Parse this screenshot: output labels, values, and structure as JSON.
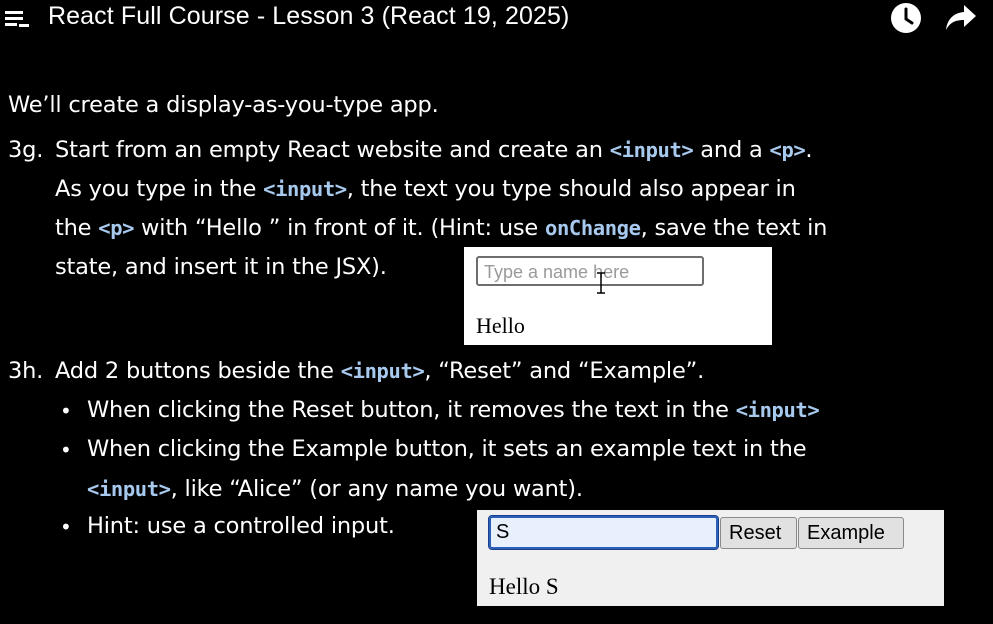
{
  "header": {
    "title": "React Full Course - Lesson 3 (React 19, 2025)",
    "icons": [
      "playlist-menu-icon",
      "watch-later-clock-icon",
      "share-arrow-icon"
    ]
  },
  "slide": {
    "intro": "We’ll create a display-as-you-type app.",
    "task_3g": {
      "number": "3g.",
      "line1_a": "Start from an empty React website and create an ",
      "line1_code1": "<input>",
      "line1_b": " and a ",
      "line1_code2": "<p>",
      "line1_c": ".",
      "line2_a": "As you type in the ",
      "line2_code": "<input>",
      "line2_b": ", the text you type should also appear in",
      "line3_a": "the ",
      "line3_code1": "<p>",
      "line3_b": " with “Hello ” in front of it. (Hint: use ",
      "line3_code2": "onChange",
      "line3_c": ", save the text in",
      "line4": "state, and insert it in the JSX)."
    },
    "demo_3g": {
      "input_placeholder": "Type a name here",
      "output": "Hello"
    },
    "task_3h": {
      "number": "3h.",
      "line1_a": "Add 2 buttons beside the ",
      "line1_code": "<input>",
      "line1_b": ", “Reset” and “Example”.",
      "bullet1_a": "When clicking the Reset button, it removes the text in the ",
      "bullet1_code": "<input>",
      "bullet2_a": "When clicking the Example button, it sets an example text in the",
      "bullet2_code": "<input>",
      "bullet2_b": ", like “Alice” (or any name you want).",
      "bullet3": "Hint: use a controlled input.",
      "bullet_char": "•"
    },
    "demo_3h": {
      "input_value": "S",
      "reset_label": "Reset",
      "example_label": "Example",
      "output": "Hello S"
    }
  }
}
